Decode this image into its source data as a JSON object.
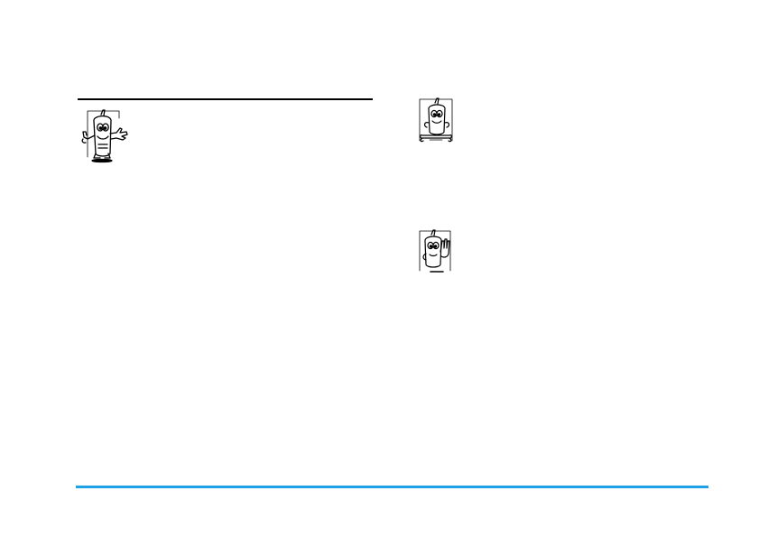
{
  "theme": {
    "accent_rule_color": "#1ea1e6",
    "text_rule_color": "#000000"
  },
  "illustrations": [
    {
      "icon": "waving-phone-icon"
    },
    {
      "icon": "phone-with-bone-icon"
    },
    {
      "icon": "phone-stop-hand-icon"
    }
  ]
}
